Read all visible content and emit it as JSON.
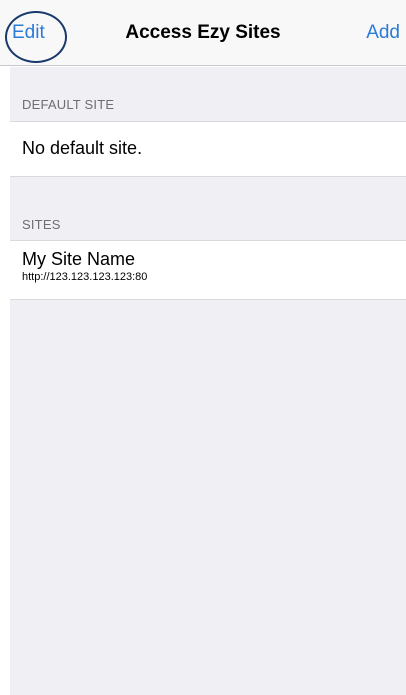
{
  "nav": {
    "title": "Access Ezy Sites",
    "edit_label": "Edit",
    "add_label": "Add",
    "accent_color": "#2a7bd6"
  },
  "sections": {
    "default_site": {
      "header": "DEFAULT SITE",
      "value": "No default site."
    },
    "sites": {
      "header": "SITES",
      "items": [
        {
          "name": "My Site Name",
          "url": "http://123.123.123.123:80"
        }
      ]
    }
  }
}
